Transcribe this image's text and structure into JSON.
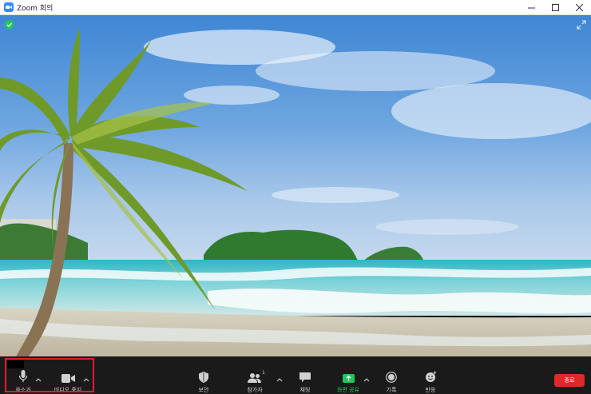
{
  "window": {
    "title": "Zoom 회의",
    "controls": [
      "minimize-icon",
      "maximize-icon",
      "close-icon"
    ]
  },
  "video": {
    "description_icon_top_left": "security-shield-icon",
    "description_icon_top_right": "expand-icon"
  },
  "toolbar": {
    "items": [
      {
        "label": "음소거",
        "icon": "microphone-icon"
      },
      {
        "label": "비디오 중지",
        "icon": "video-camera-icon"
      },
      {
        "label": "보안",
        "icon": "shield-icon"
      },
      {
        "label": "참가자",
        "icon": "participants-icon",
        "count": "1"
      },
      {
        "label": "채팅",
        "icon": "chat-icon"
      },
      {
        "label": "화면 공유",
        "icon": "share-screen-icon"
      },
      {
        "label": "기록",
        "icon": "record-icon"
      },
      {
        "label": "반응",
        "icon": "reaction-icon"
      }
    ],
    "end_label": "종료"
  },
  "colors": {
    "toolbar_bg": "#1a1a1a",
    "share_green": "#22c55e",
    "end_red": "#e02828",
    "highlight_red": "#e11d2a"
  }
}
